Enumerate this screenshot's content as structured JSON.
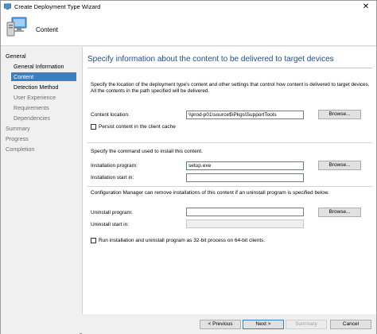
{
  "window": {
    "title": "Create Deployment Type Wizard",
    "header_title": "Content"
  },
  "nav": {
    "items": [
      {
        "label": "General",
        "level": 0,
        "state": "normal"
      },
      {
        "label": "General Information",
        "level": 1,
        "state": "normal"
      },
      {
        "label": "Content",
        "level": 1,
        "state": "selected"
      },
      {
        "label": "Detection Method",
        "level": 1,
        "state": "normal"
      },
      {
        "label": "User Experience",
        "level": 1,
        "state": "dim"
      },
      {
        "label": "Requirements",
        "level": 1,
        "state": "dim"
      },
      {
        "label": "Dependencies",
        "level": 1,
        "state": "dim"
      },
      {
        "label": "Summary",
        "level": 0,
        "state": "dim"
      },
      {
        "label": "Progress",
        "level": 0,
        "state": "dim"
      },
      {
        "label": "Completion",
        "level": 0,
        "state": "dim"
      }
    ]
  },
  "main": {
    "heading": "Specify information about the content to be delivered to target devices",
    "description": "Specify the location of the deployment type's content and other settings that control how content is delivered to target devices. All the contents in the path specified will be delivered.",
    "content_location_label": "Content location:",
    "content_location_value": "\\\\prod-p01\\source$\\Pkgs\\SupportTools",
    "persist_label": "Persist content in the client cache",
    "install_section_text": "Specify the command used to install this content.",
    "install_program_label": "Installation program:",
    "install_program_value": "setup.exe",
    "install_start_label": "Installation start in:",
    "install_start_value": "",
    "uninstall_section_text": "Configuration Manager can remove installations of this content if an uninstall program is specified below.",
    "uninstall_program_label": "Uninstall program:",
    "uninstall_program_value": "",
    "uninstall_start_label": "Uninstall start in:",
    "uninstall_start_value": "",
    "run32_label": "Run installation and uninstall program as 32-bit process on 64-bit clients.",
    "browse_label": "Browse..."
  },
  "footer": {
    "previous_label": "< Previous",
    "next_label": "Next >",
    "summary_label": "Summary",
    "cancel_label": "Cancel"
  },
  "colors": {
    "heading": "#1e4e8a",
    "selection": "#3c7fc1"
  }
}
